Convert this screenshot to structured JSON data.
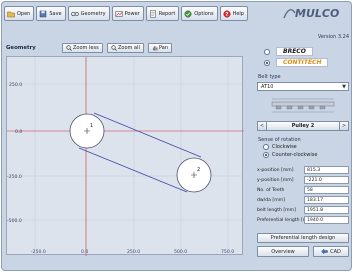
{
  "toolbar": {
    "open": "Open",
    "save": "Save",
    "geometry": "Geometry",
    "power": "Power",
    "report": "Report",
    "options": "Options",
    "help": "Help"
  },
  "brand": {
    "logo": "MULCO",
    "version": "Version 3.24"
  },
  "geometry": {
    "title": "Geometry",
    "zoom_less": "Zoom less",
    "zoom_all": "Zoom all",
    "pan": "Pan",
    "x_ticks": [
      "-250.0",
      "0.0",
      "250.0",
      "500.0",
      "750.0"
    ],
    "y_ticks": [
      "250.0",
      "0.0",
      "-250.0",
      "-500.0"
    ],
    "pulley1_label": "1",
    "pulley2_label": "2"
  },
  "brands": {
    "breco": "BRECO",
    "conti": "CONTITECH",
    "breco_selected": false,
    "conti_selected": true
  },
  "belt_type": {
    "label": "Belt type",
    "value": "AT10"
  },
  "pulley_nav": {
    "prev": "<",
    "label": "Pulley 2",
    "next": ">"
  },
  "sense": {
    "title": "Sense of rotation",
    "clockwise": "Clockwise",
    "counter": "Counter-clockwise",
    "selected": "counter"
  },
  "fields": [
    {
      "label": "x-position [mm]",
      "value": "815.3"
    },
    {
      "label": "y-position [mm]",
      "value": "-221.0"
    },
    {
      "label": "No. of Teeth",
      "value": "58"
    },
    {
      "label": "dw/da [mm]",
      "value": "183.17"
    },
    {
      "label": "belt length [mm]",
      "value": "1951.8"
    },
    {
      "label": "Preferential length [mm]",
      "value": "1940.0"
    }
  ],
  "buttons": {
    "pref_design": "Preferential length design",
    "overview": "Overview",
    "cad": "CAD"
  },
  "colors": {
    "accent": "#1d2d55",
    "belt": "#3d49a8",
    "panel": "#c9d5e4",
    "plot_bg": "#dde3ed"
  }
}
